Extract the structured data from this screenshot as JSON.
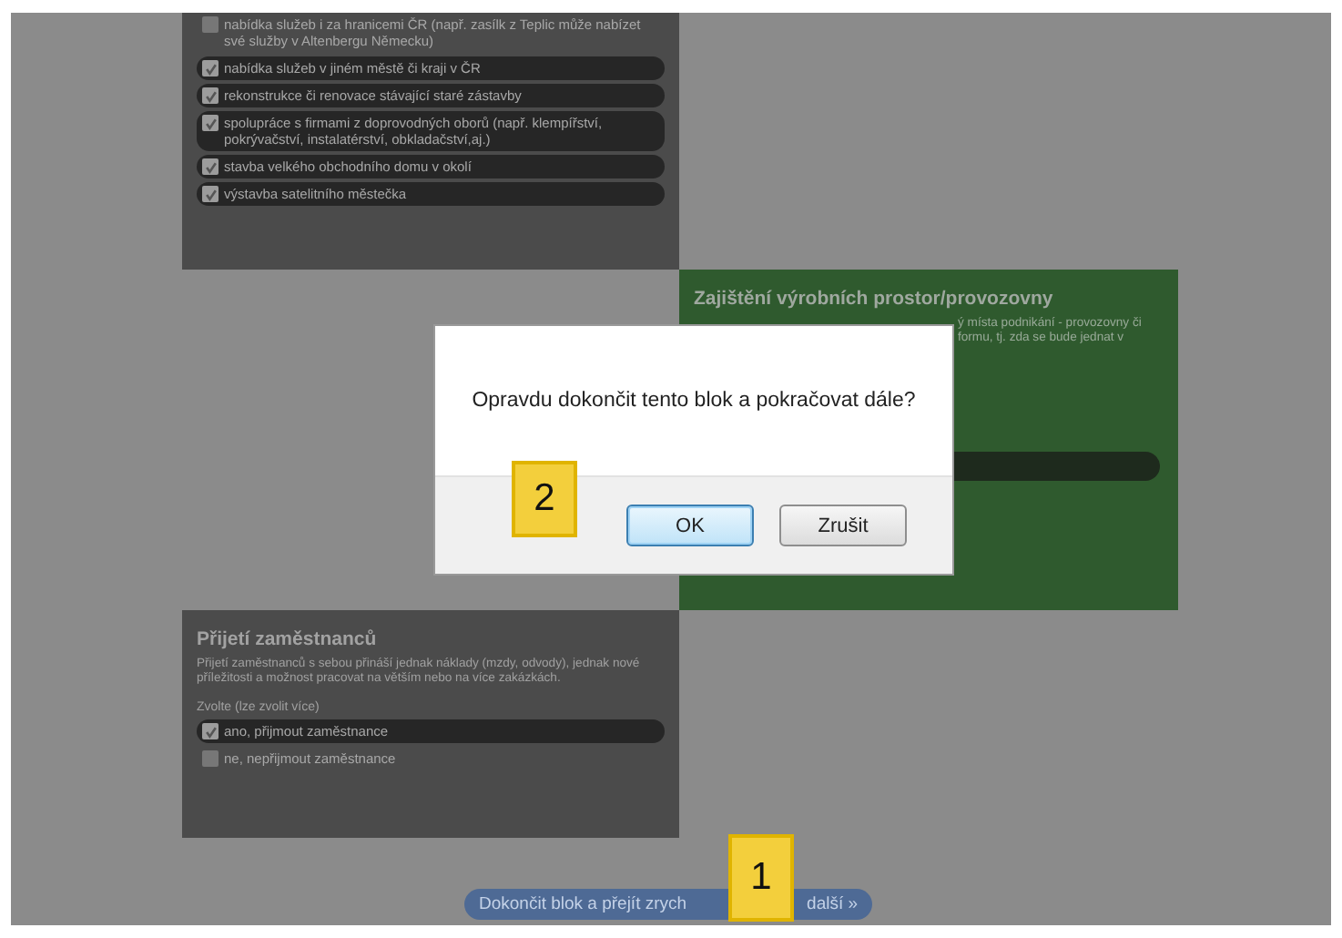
{
  "top_panel": {
    "items": [
      {
        "label": "nabídka služeb i za hranicemi ČR (např. zasílk z Teplic může nabízet své služby v Altenbergu Německu)",
        "checked": false
      },
      {
        "label": "nabídka služeb v jiném městě či kraji v ČR",
        "checked": true
      },
      {
        "label": "rekonstrukce či renovace stávající staré zástavby",
        "checked": true
      },
      {
        "label": "spolupráce s firmami z doprovodných oborů (např. klempířství, pokrývačství, instalatérství, obkladačství,aj.)",
        "checked": true
      },
      {
        "label": "stavba velkého obchodního domu v okolí",
        "checked": true
      },
      {
        "label": "výstavba satelitního městečka",
        "checked": true
      }
    ]
  },
  "production_panel": {
    "title": "Zajištění výrobních prostor/provozovny",
    "description_lines": [
      "ý místa podnikání - provozovny či",
      "formu, tj. zda se bude jednat v"
    ]
  },
  "employees_panel": {
    "title": "Přijetí zaměstnanců",
    "description": "Přijetí zaměstnanců s sebou přináší jednak náklady (mzdy, odvody), jednak nové příležitosti a možnost pracovat na větším nebo na více zakázkách.",
    "prompt": "Zvolte (lze zvolit více)",
    "options": [
      {
        "label": "ano, přijmout zaměstnance",
        "checked": true
      },
      {
        "label": "ne, nepřijmout zaměstnance",
        "checked": false
      }
    ]
  },
  "finish_button": {
    "label_parts": [
      "Dokončit blok a přejít zrych",
      "další »"
    ]
  },
  "dialog": {
    "message": "Opravdu dokončit tento blok a pokračovat dále?",
    "buttons": [
      {
        "label": "OK",
        "kind": "default"
      },
      {
        "label": "Zrušit",
        "kind": "normal"
      }
    ]
  },
  "callouts": [
    {
      "label": "1"
    },
    {
      "label": "2"
    }
  ]
}
